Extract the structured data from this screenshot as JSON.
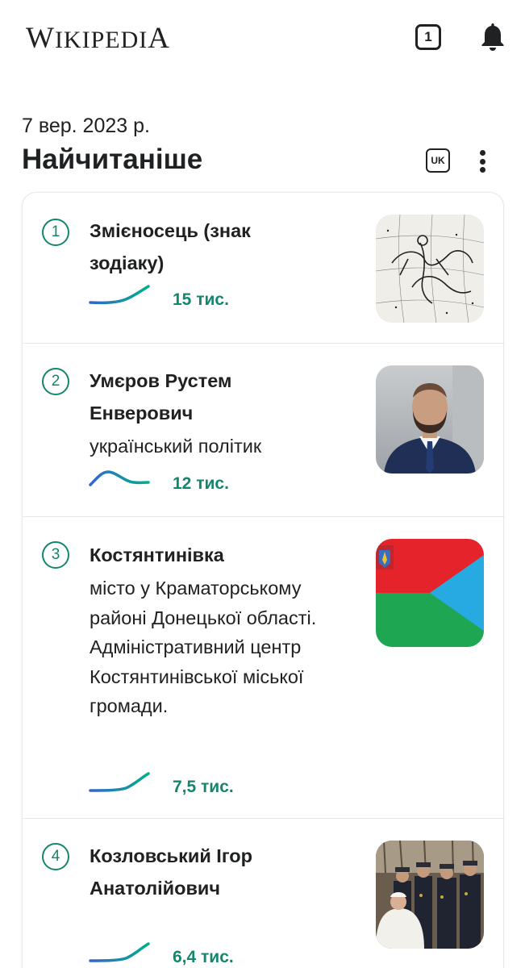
{
  "header": {
    "logo_text": "Wikipedia",
    "tabs_count": "1"
  },
  "feed": {
    "date": "7 вер. 2023 р.",
    "section_title": "Найчитаніше",
    "language_code": "UK"
  },
  "articles": [
    {
      "rank": "1",
      "title": "Змієносець (знак зодіаку)",
      "description": "",
      "views": "15 тис.",
      "trend": "rising",
      "thumbnail": "constellation-engraving"
    },
    {
      "rank": "2",
      "title": "Умєров Рустем Енверович",
      "description": "український політик",
      "views": "12 тис.",
      "trend": "peak-then-drop",
      "thumbnail": "portrait-man-in-suit"
    },
    {
      "rank": "3",
      "title": "Костянтинівка",
      "description": "місто у Краматорському районі Донецької області. Адміністративний центр Костянтинівської міської громади.",
      "views": "7,5 тис.",
      "trend": "rising",
      "thumbnail": "city-flag"
    },
    {
      "rank": "4",
      "title": "Козловський Ігор Анатолійович",
      "description": "",
      "views": "6,4 тис.",
      "trend": "rising",
      "thumbnail": "group-photo"
    }
  ],
  "colors": {
    "accent_green": "#14866d",
    "spark_start": "#3366cc",
    "spark_end": "#00af89",
    "text": "#202122",
    "divider": "#e6e8eb"
  }
}
